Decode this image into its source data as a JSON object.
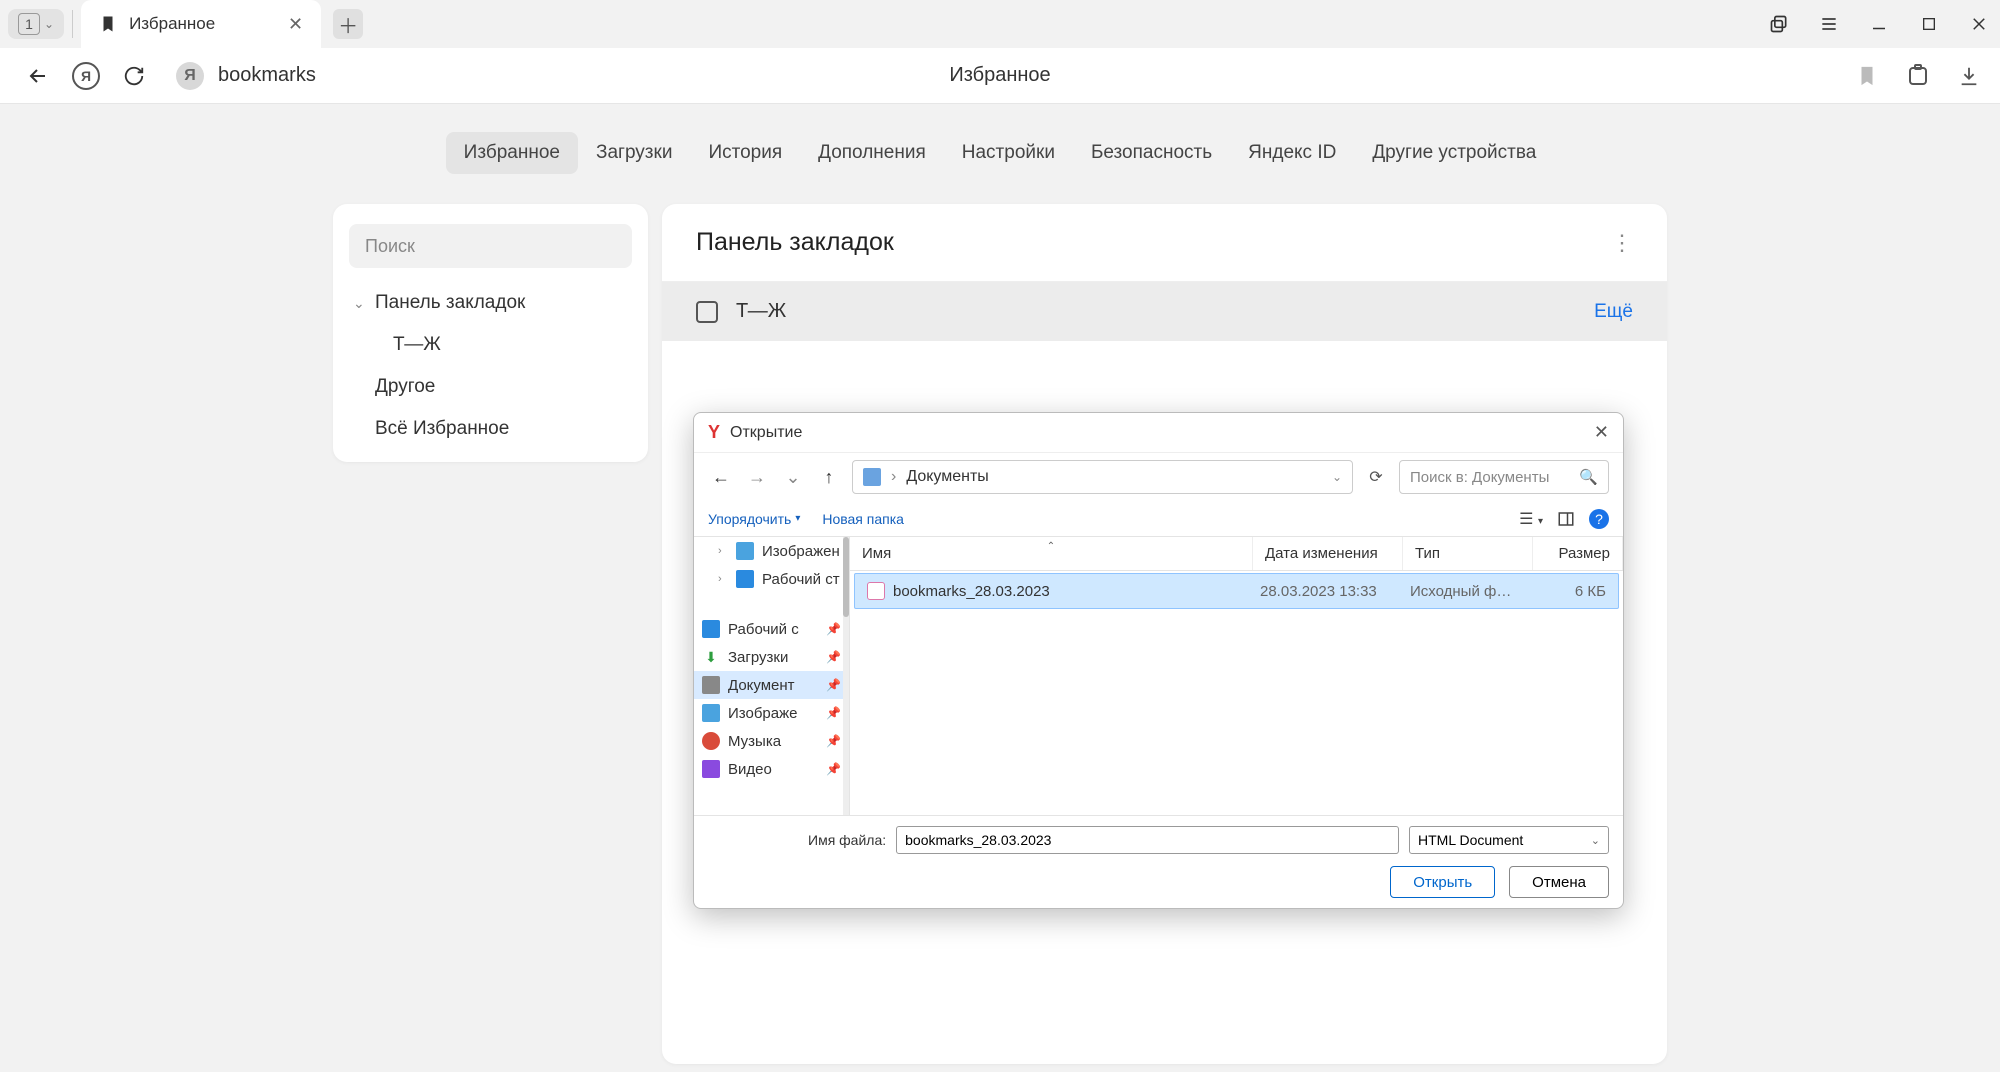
{
  "browser": {
    "tab_count": "1",
    "tab_title": "Избранное",
    "url_text": "bookmarks",
    "page_title": "Избранное"
  },
  "settings_nav": [
    "Избранное",
    "Загрузки",
    "История",
    "Дополнения",
    "Настройки",
    "Безопасность",
    "Яндекс ID",
    "Другие устройства"
  ],
  "sidebar": {
    "search_placeholder": "Поиск",
    "root": "Панель закладок",
    "child": "Т—Ж",
    "other": "Другое",
    "all": "Всё Избранное"
  },
  "panel": {
    "title": "Панель закладок",
    "item": "Т—Ж",
    "more": "Ещё"
  },
  "dialog": {
    "title": "Открытие",
    "breadcrumb": "Документы",
    "search_placeholder": "Поиск в: Документы",
    "organize": "Упорядочить",
    "new_folder": "Новая папка",
    "columns": {
      "name": "Имя",
      "date": "Дата изменения",
      "type": "Тип",
      "size": "Размер"
    },
    "tree": {
      "images1": "Изображен",
      "desktop1": "Рабочий ст",
      "desktop2": "Рабочий с",
      "downloads": "Загрузки",
      "documents": "Документ",
      "images2": "Изображе",
      "music": "Музыка",
      "video": "Видео"
    },
    "file": {
      "name": "bookmarks_28.03.2023",
      "date": "28.03.2023 13:33",
      "type": "Исходный фа…",
      "size": "6 КБ"
    },
    "filename_label": "Имя файла:",
    "filename_value": "bookmarks_28.03.2023",
    "file_type_filter": "HTML Document",
    "open": "Открыть",
    "cancel": "Отмена"
  }
}
